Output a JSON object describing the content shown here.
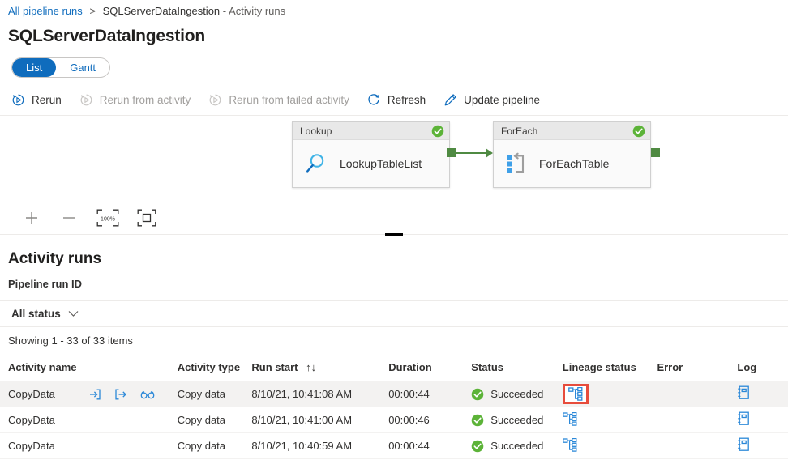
{
  "breadcrumb": {
    "root_label": "All pipeline runs",
    "separator": ">",
    "current_label": "SQLServerDataIngestion",
    "current_dash": "-",
    "current_suffix": "Activity runs"
  },
  "page": {
    "title": "SQLServerDataIngestion"
  },
  "view_toggle": {
    "list_label": "List",
    "gantt_label": "Gantt",
    "selected": "List"
  },
  "commandbar": {
    "rerun_label": "Rerun",
    "rerun_from_activity_label": "Rerun from activity",
    "rerun_from_failed_label": "Rerun from failed activity",
    "refresh_label": "Refresh",
    "update_pipeline_label": "Update pipeline"
  },
  "canvas": {
    "nodes": [
      {
        "type_label": "Lookup",
        "name": "LookupTableList",
        "status": "Succeeded",
        "icon": "magnifier-icon"
      },
      {
        "type_label": "ForEach",
        "name": "ForEachTable",
        "status": "Succeeded",
        "icon": "foreach-loop-icon"
      }
    ],
    "controls": {
      "zoom_in": "+",
      "zoom_out": "—",
      "zoom_level": "100%",
      "fit_label": "Fit to screen"
    }
  },
  "activity_runs": {
    "section_title": "Activity runs",
    "pipeline_run_id_label": "Pipeline run ID",
    "status_filter_label": "All status",
    "showing_text": "Showing 1 - 33 of 33 items",
    "columns": [
      "Activity name",
      "Activity type",
      "Run start",
      "Duration",
      "Status",
      "Lineage status",
      "Error",
      "Log"
    ],
    "sort_indicator": "↑↓",
    "rows": [
      {
        "name": "CopyData",
        "type": "Copy data",
        "run_start": "8/10/21, 10:41:08 AM",
        "duration": "00:00:44",
        "status": "Succeeded",
        "error": "",
        "selected": true,
        "lineage_highlighted": true
      },
      {
        "name": "CopyData",
        "type": "Copy data",
        "run_start": "8/10/21, 10:41:00 AM",
        "duration": "00:00:46",
        "status": "Succeeded",
        "error": "",
        "selected": false,
        "lineage_highlighted": false
      },
      {
        "name": "CopyData",
        "type": "Copy data",
        "run_start": "8/10/21, 10:40:59 AM",
        "duration": "00:00:44",
        "status": "Succeeded",
        "error": "",
        "selected": false,
        "lineage_highlighted": false
      }
    ]
  },
  "colors": {
    "accent": "#0f6cbd",
    "success": "#5cb338",
    "connector": "#4f8a42",
    "highlight": "#e74c3c"
  }
}
